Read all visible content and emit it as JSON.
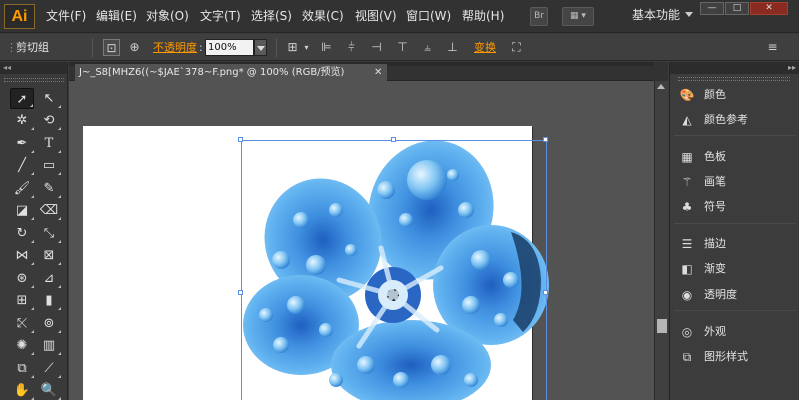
{
  "menubar": {
    "logo": "Ai",
    "menus": [
      "文件(F)",
      "编辑(E)",
      "对象(O)",
      "文字(T)",
      "选择(S)",
      "效果(C)",
      "视图(V)",
      "窗口(W)",
      "帮助(H)"
    ],
    "bridge_label": "Br",
    "workspace": "基本功能",
    "window_controls": [
      "—",
      "□",
      "✕"
    ]
  },
  "controlbar": {
    "selection_label": "剪切组",
    "opacity_label": "不透明度",
    "opacity_value": "100%",
    "transform_label": "变换"
  },
  "document": {
    "tab_title": "J~_S8[MHZ6((~$JAE`378~F.png* @ 100% (RGB/预览)",
    "tab_close": "✕"
  },
  "right_panel": {
    "items": [
      {
        "icon": "palette-icon",
        "label": "颜色"
      },
      {
        "icon": "color-guide-icon",
        "label": "颜色参考"
      },
      {
        "icon": "swatches-icon",
        "label": "色板"
      },
      {
        "icon": "brush-icon",
        "label": "画笔"
      },
      {
        "icon": "symbol-icon",
        "label": "符号"
      },
      {
        "icon": "stroke-icon",
        "label": "描边"
      },
      {
        "icon": "gradient-icon",
        "label": "渐变"
      },
      {
        "icon": "transparency-icon",
        "label": "透明度"
      },
      {
        "icon": "appearance-icon",
        "label": "外观"
      },
      {
        "icon": "graphic-styles-icon",
        "label": "图形样式"
      }
    ]
  },
  "colors": {
    "accent_orange": "#ff9a00",
    "selection_blue": "#5a8fe6",
    "petal_blue": "#4aa3e8"
  }
}
